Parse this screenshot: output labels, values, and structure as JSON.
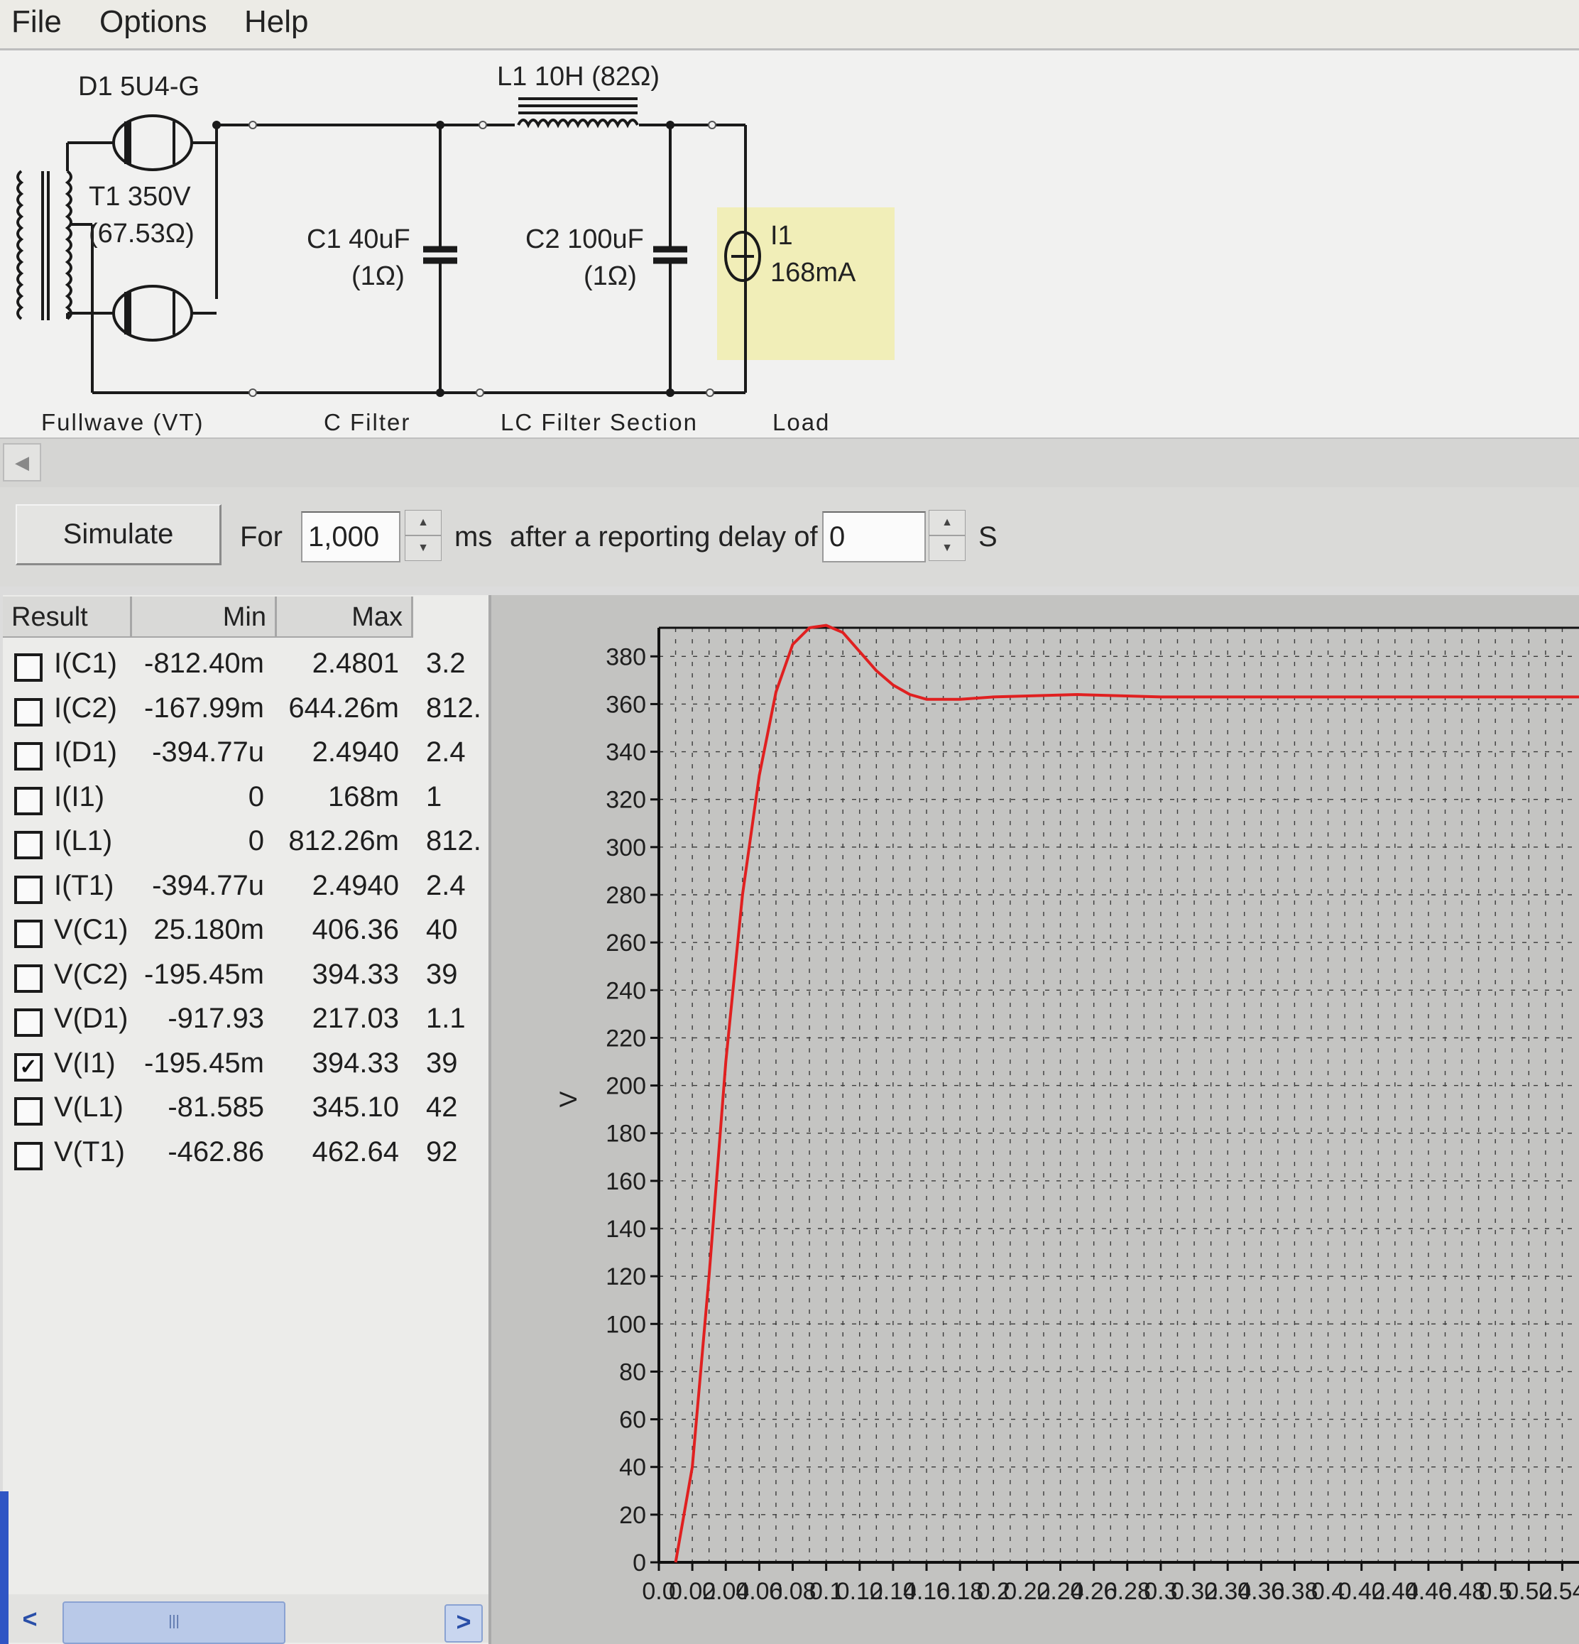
{
  "menu": {
    "items": [
      {
        "label": "File"
      },
      {
        "label": "Options"
      },
      {
        "label": "Help"
      }
    ]
  },
  "schematic": {
    "d1": "D1 5U4-G",
    "t1_line1": "T1 350V",
    "t1_line2": "(67.53Ω)",
    "l1": "L1 10H (82Ω)",
    "c1_line1": "C1 40uF",
    "c1_line2": "(1Ω)",
    "c2_line1": "C2 100uF",
    "c2_line2": "(1Ω)",
    "i1_line1": "I1",
    "i1_line2": "168mA",
    "sections": {
      "fullwave": "Fullwave (VT)",
      "cfilter": "C Filter",
      "lcfilter": "LC Filter Section",
      "load": "Load"
    }
  },
  "controls": {
    "simulate_label": "Simulate",
    "for_label": "For",
    "duration_value": "1,000",
    "duration_unit": "ms",
    "delay_label": "after a reporting delay of",
    "delay_value": "0",
    "delay_unit": "S"
  },
  "results": {
    "columns": [
      "Result",
      "Min",
      "Max"
    ],
    "rows": [
      {
        "name": "I(C1)",
        "min": "-812.40m",
        "max": "2.4801",
        "extra": "3.2",
        "checked": false
      },
      {
        "name": "I(C2)",
        "min": "-167.99m",
        "max": "644.26m",
        "extra": "812.",
        "checked": false
      },
      {
        "name": "I(D1)",
        "min": "-394.77u",
        "max": "2.4940",
        "extra": "2.4",
        "checked": false
      },
      {
        "name": "I(I1)",
        "min": "0",
        "max": "168m",
        "extra": "1",
        "checked": false
      },
      {
        "name": "I(L1)",
        "min": "0",
        "max": "812.26m",
        "extra": "812.",
        "checked": false
      },
      {
        "name": "I(T1)",
        "min": "-394.77u",
        "max": "2.4940",
        "extra": "2.4",
        "checked": false
      },
      {
        "name": "V(C1)",
        "min": "25.180m",
        "max": "406.36",
        "extra": "40",
        "checked": false
      },
      {
        "name": "V(C2)",
        "min": "-195.45m",
        "max": "394.33",
        "extra": "39",
        "checked": false
      },
      {
        "name": "V(D1)",
        "min": "-917.93",
        "max": "217.03",
        "extra": "1.1",
        "checked": false
      },
      {
        "name": "V(I1)",
        "min": "-195.45m",
        "max": "394.33",
        "extra": "39",
        "checked": true
      },
      {
        "name": "V(L1)",
        "min": "-81.585",
        "max": "345.10",
        "extra": "42",
        "checked": false
      },
      {
        "name": "V(T1)",
        "min": "-462.86",
        "max": "462.64",
        "extra": "92",
        "checked": false
      }
    ],
    "scroll_thumb_glyph": "|||"
  },
  "chart_data": {
    "type": "line",
    "ylabel": "V",
    "ylim": [
      0,
      392
    ],
    "xlim": [
      0,
      0.55
    ],
    "yticks": [
      0,
      20,
      40,
      60,
      80,
      100,
      120,
      140,
      160,
      180,
      200,
      220,
      240,
      260,
      280,
      300,
      320,
      340,
      360,
      380
    ],
    "xticks": [
      "0.0",
      "0.02",
      "0.04",
      "0.06",
      "0.08",
      "0.1",
      "0.12",
      "0.14",
      "0.16",
      "0.18",
      "0.2",
      "0.22",
      "0.24",
      "0.26",
      "0.28",
      "0.3",
      "0.32",
      "0.34",
      "0.36",
      "0.38",
      "0.4",
      "0.42",
      "0.44",
      "0.46",
      "0.48",
      "0.5",
      "0.52",
      "0.54"
    ],
    "grid": true,
    "series": [
      {
        "color": "#e02020",
        "x": [
          0.01,
          0.02,
          0.03,
          0.04,
          0.05,
          0.06,
          0.07,
          0.08,
          0.09,
          0.1,
          0.11,
          0.12,
          0.13,
          0.14,
          0.15,
          0.16,
          0.17,
          0.18,
          0.2,
          0.25,
          0.3,
          0.35,
          0.4,
          0.45,
          0.5,
          0.55
        ],
        "y": [
          0,
          40,
          120,
          210,
          280,
          330,
          365,
          385,
          392,
          393,
          390,
          382,
          374,
          368,
          364,
          362,
          362,
          362,
          363,
          364,
          363,
          363,
          363,
          363,
          363,
          363
        ]
      }
    ]
  },
  "colors": {
    "curve": "#e02020",
    "load_highlight": "#f1eeb8",
    "scroll_accent": "#2f55c4"
  }
}
